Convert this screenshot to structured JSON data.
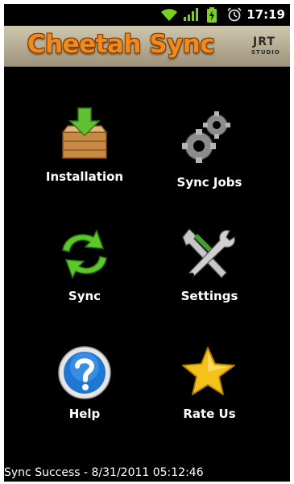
{
  "status_bar": {
    "time": "17:19",
    "icons": [
      "wifi-icon",
      "signal-icon",
      "battery-charging-icon",
      "alarm-icon"
    ]
  },
  "header": {
    "title": "Cheetah Sync",
    "logo_line1": "JRT",
    "logo_line2": "STUDIO"
  },
  "menu": [
    {
      "id": "installation",
      "label": "Installation",
      "icon": "download-box-icon"
    },
    {
      "id": "sync-jobs",
      "label": "Sync Jobs",
      "icon": "gears-icon"
    },
    {
      "id": "sync",
      "label": "Sync",
      "icon": "sync-arrows-icon"
    },
    {
      "id": "settings",
      "label": "Settings",
      "icon": "tools-icon"
    },
    {
      "id": "help",
      "label": "Help",
      "icon": "help-icon"
    },
    {
      "id": "rate-us",
      "label": "Rate Us",
      "icon": "star-icon"
    }
  ],
  "status_message": "Sync Success - 8/31/2011 05:12:46",
  "colors": {
    "title": "#f08a1e",
    "header_bg": "#b2a88f",
    "background": "#000000"
  }
}
